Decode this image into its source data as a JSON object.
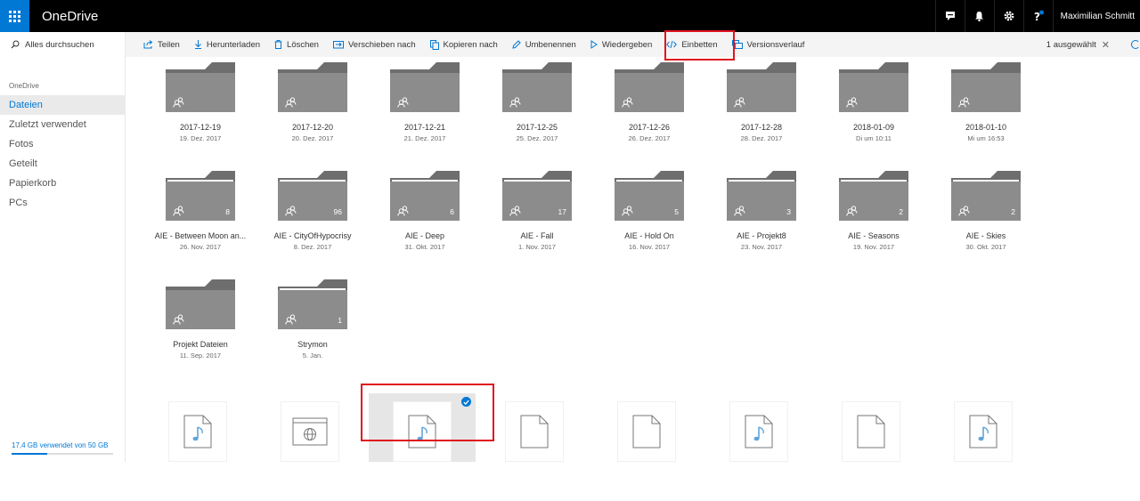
{
  "app": {
    "title": "OneDrive"
  },
  "topbar": {
    "icons": [
      "chat-icon",
      "bell-icon",
      "gear-icon",
      "help-icon"
    ],
    "user": "Maximilian Schmitt"
  },
  "search": {
    "placeholder": "Alles durchsuchen"
  },
  "commands": [
    {
      "label": "Teilen",
      "icon": "share-icon"
    },
    {
      "label": "Herunterladen",
      "icon": "download-icon"
    },
    {
      "label": "Löschen",
      "icon": "trash-icon"
    },
    {
      "label": "Verschieben nach",
      "icon": "move-icon"
    },
    {
      "label": "Kopieren nach",
      "icon": "copy-icon"
    },
    {
      "label": "Umbenennen",
      "icon": "rename-icon"
    },
    {
      "label": "Wiedergeben",
      "icon": "play-icon"
    },
    {
      "label": "Einbetten",
      "icon": "embed-icon"
    },
    {
      "label": "Versionsverlauf",
      "icon": "version-history-icon"
    }
  ],
  "selection": {
    "label": "1 ausgewählt"
  },
  "nav": {
    "heading": "OneDrive",
    "items": [
      {
        "label": "Dateien",
        "active": true
      },
      {
        "label": "Zuletzt verwendet",
        "active": false
      },
      {
        "label": "Fotos",
        "active": false
      },
      {
        "label": "Geteilt",
        "active": false
      },
      {
        "label": "Papierkorb",
        "active": false
      },
      {
        "label": "PCs",
        "active": false
      }
    ],
    "storage": {
      "label": "17,4 GB verwendet von 50 GB",
      "used_fraction": 0.348
    }
  },
  "folders": [
    {
      "name": "2017-12-19",
      "date": "19. Dez. 2017",
      "count": ""
    },
    {
      "name": "2017-12-20",
      "date": "20. Dez. 2017",
      "count": ""
    },
    {
      "name": "2017-12-21",
      "date": "21. Dez. 2017",
      "count": ""
    },
    {
      "name": "2017-12-25",
      "date": "25. Dez. 2017",
      "count": ""
    },
    {
      "name": "2017-12-26",
      "date": "26. Dez. 2017",
      "count": ""
    },
    {
      "name": "2017-12-28",
      "date": "28. Dez. 2017",
      "count": ""
    },
    {
      "name": "2018-01-09",
      "date": "Di um 10:11",
      "count": ""
    },
    {
      "name": "2018-01-10",
      "date": "Mi um 16:53",
      "count": ""
    },
    {
      "name": "AIE - Between Moon an...",
      "date": "26. Nov. 2017",
      "count": "8"
    },
    {
      "name": "AIE - CityOfHypocrisy",
      "date": "8. Dez. 2017",
      "count": "96"
    },
    {
      "name": "AIE - Deep",
      "date": "31. Okt. 2017",
      "count": "6"
    },
    {
      "name": "AIE - Fall",
      "date": "1. Nov. 2017",
      "count": "17"
    },
    {
      "name": "AIE - Hold On",
      "date": "16. Nov. 2017",
      "count": "5"
    },
    {
      "name": "AIE - Projekt8",
      "date": "23. Nov. 2017",
      "count": "3"
    },
    {
      "name": "AIE - Seasons",
      "date": "19. Nov. 2017",
      "count": "2"
    },
    {
      "name": "AIE - Skies",
      "date": "30. Okt. 2017",
      "count": "2"
    },
    {
      "name": "Projekt Dateien",
      "date": "11. Sep. 2017",
      "count": ""
    },
    {
      "name": "Strymon",
      "date": "5. Jan.",
      "count": "1"
    }
  ],
  "files": [
    {
      "icon": "audio-file-icon",
      "selected": false
    },
    {
      "icon": "web-file-icon",
      "selected": false
    },
    {
      "icon": "audio-file-icon",
      "selected": true
    },
    {
      "icon": "blank-file-icon",
      "selected": false
    },
    {
      "icon": "blank-file-icon",
      "selected": false
    },
    {
      "icon": "audio-file-icon",
      "selected": false
    },
    {
      "icon": "blank-file-icon",
      "selected": false
    },
    {
      "icon": "audio-file-icon",
      "selected": false
    }
  ],
  "colors": {
    "accent": "#0078d4",
    "folder": "#8c8c8c",
    "folder_tab": "#6e6e6e",
    "highlight": "#e0141e",
    "audio_note": "#5fa4d8"
  }
}
